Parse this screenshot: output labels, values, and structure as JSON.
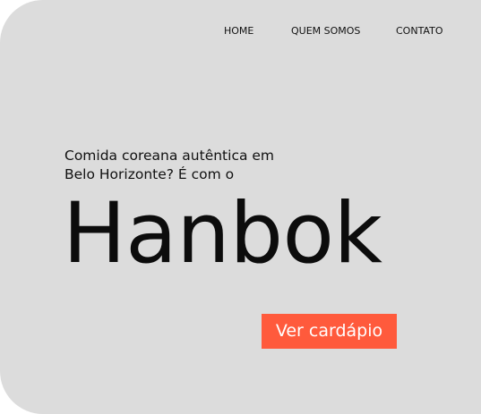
{
  "nav": {
    "items": [
      {
        "label": "HOME"
      },
      {
        "label": "QUEM SOMOS"
      },
      {
        "label": "CONTATO"
      }
    ]
  },
  "hero": {
    "tagline": "Comida coreana autêntica em Belo Horizonte? É com o",
    "brand": "Hanbok",
    "cta_label": "Ver cardápio"
  },
  "colors": {
    "background": "#dcdcdc",
    "accent": "#ff5a3c",
    "text": "#111111"
  }
}
